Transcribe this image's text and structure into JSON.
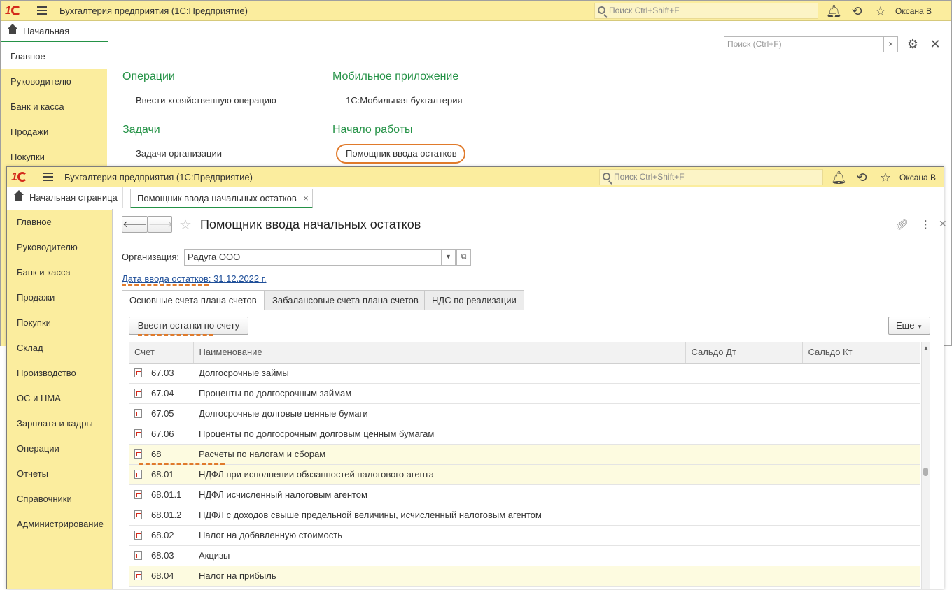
{
  "back_window": {
    "app_title": "Бухгалтерия предприятия  (1С:Предприятие)",
    "global_search_placeholder": "Поиск Ctrl+Shift+F",
    "user_name": "Оксана В",
    "home_tab_label": "Начальная страница",
    "sidebar_items": [
      "Главное",
      "Руководителю",
      "Банк и касса",
      "Продажи",
      "Покупки"
    ],
    "panel_search_placeholder": "Поиск (Ctrl+F)",
    "sections": [
      {
        "title": "Операции",
        "links": [
          "Ввести хозяйственную операцию"
        ]
      },
      {
        "title": "Мобильное приложение",
        "links": [
          "1С:Мобильная бухгалтерия"
        ]
      },
      {
        "title": "Задачи",
        "links": [
          "Задачи организации"
        ]
      },
      {
        "title": "Начало работы",
        "links": [
          "Помощник ввода остатков"
        ]
      }
    ]
  },
  "front_window": {
    "app_title": "Бухгалтерия предприятия  (1С:Предприятие)",
    "global_search_placeholder": "Поиск Ctrl+Shift+F",
    "user_name": "Оксана В",
    "tabs": [
      "Начальная страница",
      "Помощник ввода начальных остатков"
    ],
    "sidebar_items": [
      "Главное",
      "Руководителю",
      "Банк и касса",
      "Продажи",
      "Покупки",
      "Склад",
      "Производство",
      "ОС и НМА",
      "Зарплата и кадры",
      "Операции",
      "Отчеты",
      "Справочники",
      "Администрирование"
    ],
    "form_title": "Помощник ввода начальных остатков",
    "org_label": "Организация:",
    "org_value": "Радуга ООО",
    "date_link": "Дата ввода остатков: 31.12.2022 г.",
    "form_tabs": [
      "Основные счета плана счетов",
      "Забалансовые счета плана счетов",
      "НДС по реализации"
    ],
    "enter_balance_button": "Ввести остатки по счету",
    "more_button": "Еще",
    "columns": [
      "Счет",
      "Наименование",
      "Сальдо Дт",
      "Сальдо Кт"
    ],
    "rows": [
      {
        "code": "67.03",
        "name": "Долгосрочные займы",
        "dt": "",
        "kt": "",
        "highlight": false
      },
      {
        "code": "67.04",
        "name": "Проценты по долгосрочным займам",
        "dt": "",
        "kt": "",
        "highlight": false
      },
      {
        "code": "67.05",
        "name": "Долгосрочные долговые ценные бумаги",
        "dt": "",
        "kt": "",
        "highlight": false
      },
      {
        "code": "67.06",
        "name": "Проценты по долгосрочным долговым ценным бумагам",
        "dt": "",
        "kt": "",
        "highlight": false
      },
      {
        "code": "68",
        "name": "Расчеты по налогам и сборам",
        "dt": "",
        "kt": "",
        "highlight": true
      },
      {
        "code": "68.01",
        "name": "НДФЛ при исполнении обязанностей налогового агента",
        "dt": "",
        "kt": "",
        "highlight": true
      },
      {
        "code": "68.01.1",
        "name": "НДФЛ исчисленный налоговым агентом",
        "dt": "",
        "kt": "",
        "highlight": false
      },
      {
        "code": "68.01.2",
        "name": "НДФЛ с доходов свыше предельной величины, исчисленный налоговым агентом",
        "dt": "",
        "kt": "",
        "highlight": false
      },
      {
        "code": "68.02",
        "name": "Налог на добавленную стоимость",
        "dt": "",
        "kt": "",
        "highlight": false
      },
      {
        "code": "68.03",
        "name": "Акцизы",
        "dt": "",
        "kt": "",
        "highlight": false
      },
      {
        "code": "68.04",
        "name": "Налог на прибыль",
        "dt": "",
        "kt": "",
        "highlight": true
      }
    ]
  },
  "colors": {
    "titlebar": "#fbed9e",
    "section_green": "#249246",
    "highlight_orange": "#e07a2b",
    "row_highlight": "#fdfbe0"
  }
}
